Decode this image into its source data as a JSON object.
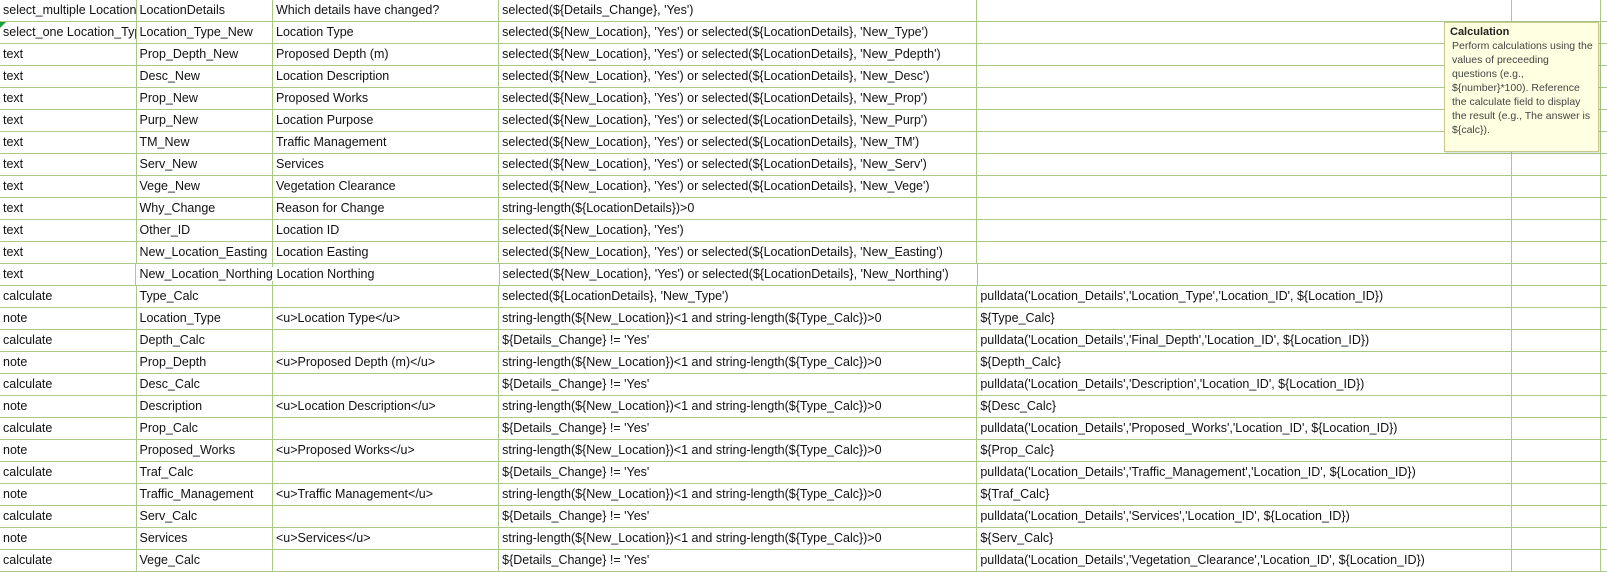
{
  "rows": [
    {
      "type": "select_multiple LocationDetails",
      "name": "LocationDetails",
      "label": "Which details have changed?",
      "relevant": "selected(${Details_Change}, 'Yes')",
      "calculation": ""
    },
    {
      "type": "select_one Location_Type",
      "name": "Location_Type_New",
      "label": "Location Type",
      "relevant": "selected(${New_Location}, 'Yes') or selected(${LocationDetails}, 'New_Type')",
      "calculation": ""
    },
    {
      "type": "text",
      "name": "Prop_Depth_New",
      "label": "Proposed Depth (m)",
      "relevant": "selected(${New_Location}, 'Yes') or selected(${LocationDetails}, 'New_Pdepth')",
      "calculation": ""
    },
    {
      "type": "text",
      "name": "Desc_New",
      "label": "Location Description",
      "relevant": "selected(${New_Location}, 'Yes') or selected(${LocationDetails}, 'New_Desc')",
      "calculation": ""
    },
    {
      "type": "text",
      "name": "Prop_New",
      "label": "Proposed Works",
      "relevant": "selected(${New_Location}, 'Yes') or selected(${LocationDetails}, 'New_Prop')",
      "calculation": ""
    },
    {
      "type": "text",
      "name": "Purp_New",
      "label": "Location Purpose",
      "relevant": "selected(${New_Location}, 'Yes') or selected(${LocationDetails}, 'New_Purp')",
      "calculation": ""
    },
    {
      "type": "text",
      "name": "TM_New",
      "label": "Traffic Management",
      "relevant": "selected(${New_Location}, 'Yes') or selected(${LocationDetails}, 'New_TM')",
      "calculation": ""
    },
    {
      "type": "text",
      "name": "Serv_New",
      "label": "Services",
      "relevant": "selected(${New_Location}, 'Yes') or selected(${LocationDetails}, 'New_Serv')",
      "calculation": ""
    },
    {
      "type": "text",
      "name": "Vege_New",
      "label": "Vegetation Clearance",
      "relevant": "selected(${New_Location}, 'Yes') or selected(${LocationDetails}, 'New_Vege')",
      "calculation": ""
    },
    {
      "type": "text",
      "name": "Why_Change",
      "label": "Reason for Change",
      "relevant": "string-length(${LocationDetails})>0",
      "calculation": ""
    },
    {
      "type": "text",
      "name": "Other_ID",
      "label": "Location ID",
      "relevant": "selected(${New_Location}, 'Yes')",
      "calculation": ""
    },
    {
      "type": "text",
      "name": "New_Location_Easting",
      "label": "Location Easting",
      "relevant": "selected(${New_Location}, 'Yes') or selected(${LocationDetails}, 'New_Easting')",
      "calculation": ""
    },
    {
      "type": "text",
      "name": "New_Location_Northing",
      "label": "Location Northing",
      "relevant": "selected(${New_Location}, 'Yes') or selected(${LocationDetails}, 'New_Northing')",
      "calculation": ""
    },
    {
      "type": "calculate",
      "name": "Type_Calc",
      "label": "",
      "relevant": "selected(${LocationDetails}, 'New_Type')",
      "calculation": "pulldata('Location_Details','Location_Type','Location_ID', ${Location_ID})"
    },
    {
      "type": "note",
      "name": "Location_Type",
      "label": "<u>Location Type</u>",
      "relevant": "string-length(${New_Location})<1 and string-length(${Type_Calc})>0",
      "calculation": "${Type_Calc}"
    },
    {
      "type": "calculate",
      "name": "Depth_Calc",
      "label": "",
      "relevant": "${Details_Change} != 'Yes'",
      "calculation": "pulldata('Location_Details','Final_Depth','Location_ID', ${Location_ID})"
    },
    {
      "type": "note",
      "name": "Prop_Depth",
      "label": "<u>Proposed Depth (m)</u>",
      "relevant": "string-length(${New_Location})<1 and string-length(${Type_Calc})>0",
      "calculation": "${Depth_Calc}"
    },
    {
      "type": "calculate",
      "name": "Desc_Calc",
      "label": "",
      "relevant": "${Details_Change} != 'Yes'",
      "calculation": "pulldata('Location_Details','Description','Location_ID', ${Location_ID})"
    },
    {
      "type": "note",
      "name": "Description",
      "label": "<u>Location Description</u>",
      "relevant": "string-length(${New_Location})<1 and string-length(${Type_Calc})>0",
      "calculation": "${Desc_Calc}"
    },
    {
      "type": "calculate",
      "name": "Prop_Calc",
      "label": "",
      "relevant": "${Details_Change} != 'Yes'",
      "calculation": "pulldata('Location_Details','Proposed_Works','Location_ID', ${Location_ID})"
    },
    {
      "type": "note",
      "name": "Proposed_Works",
      "label": "<u>Proposed Works</u>",
      "relevant": "string-length(${New_Location})<1 and string-length(${Type_Calc})>0",
      "calculation": "${Prop_Calc}"
    },
    {
      "type": "calculate",
      "name": "Traf_Calc",
      "label": "",
      "relevant": "${Details_Change} != 'Yes'",
      "calculation": "pulldata('Location_Details','Traffic_Management','Location_ID', ${Location_ID})"
    },
    {
      "type": "note",
      "name": "Traffic_Management",
      "label": "<u>Traffic Management</u>",
      "relevant": "string-length(${New_Location})<1 and string-length(${Type_Calc})>0",
      "calculation": "${Traf_Calc}"
    },
    {
      "type": "calculate",
      "name": "Serv_Calc",
      "label": "",
      "relevant": "${Details_Change} != 'Yes'",
      "calculation": "pulldata('Location_Details','Services','Location_ID', ${Location_ID})"
    },
    {
      "type": "note",
      "name": "Services",
      "label": "<u>Services</u>",
      "relevant": "string-length(${New_Location})<1 and string-length(${Type_Calc})>0",
      "calculation": "${Serv_Calc}"
    },
    {
      "type": "calculate",
      "name": "Vege_Calc",
      "label": "",
      "relevant": "${Details_Change} != 'Yes'",
      "calculation": "pulldata('Location_Details','Vegetation_Clearance','Location_ID', ${Location_ID})"
    }
  ],
  "tooltip": {
    "title": "Calculation",
    "body": "Perform calculations using the values of preceeding questions (e.g., ${number}*100). Reference the calculate field to display the result (e.g., The answer is ${calc})."
  },
  "colors": {
    "gridline": "#a9c987",
    "tooltip_bg": "#ffffe1",
    "comment_marker": "#1e9e3c"
  }
}
